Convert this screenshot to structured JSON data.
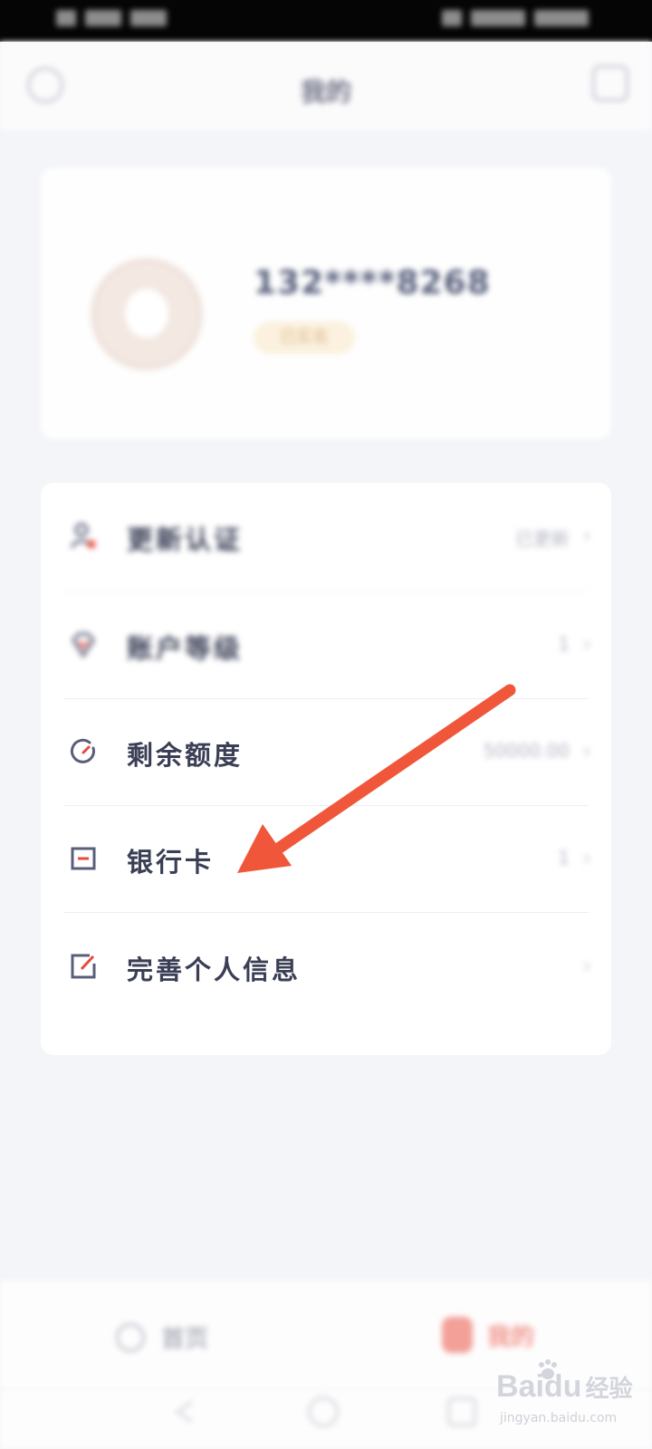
{
  "header": {
    "title": "我的"
  },
  "profile": {
    "phone": "132****8268",
    "badge": "已实名"
  },
  "menu": [
    {
      "label": "更新认证",
      "value": "已更新",
      "icon": "person-icon",
      "blurred": true
    },
    {
      "label": "账户等级",
      "value": "1",
      "icon": "diamond-icon",
      "blurred": true
    },
    {
      "label": "剩余额度",
      "value": "50000.00",
      "icon": "gauge-icon",
      "blurred": false
    },
    {
      "label": "银行卡",
      "value": "1",
      "icon": "card-icon",
      "blurred": false
    },
    {
      "label": "完善个人信息",
      "value": "",
      "icon": "edit-icon",
      "blurred": false
    }
  ],
  "tabs": [
    {
      "label": "首页",
      "active": false
    },
    {
      "label": "我的",
      "active": true
    }
  ],
  "watermark": {
    "logo": "Baidu",
    "text": "经验",
    "url": "jingyan.baidu.com"
  },
  "colors": {
    "arrow": "#f0573a",
    "accent": "#f2958c",
    "icon_red": "#e64a3c",
    "icon_gray": "#5a5f79"
  }
}
